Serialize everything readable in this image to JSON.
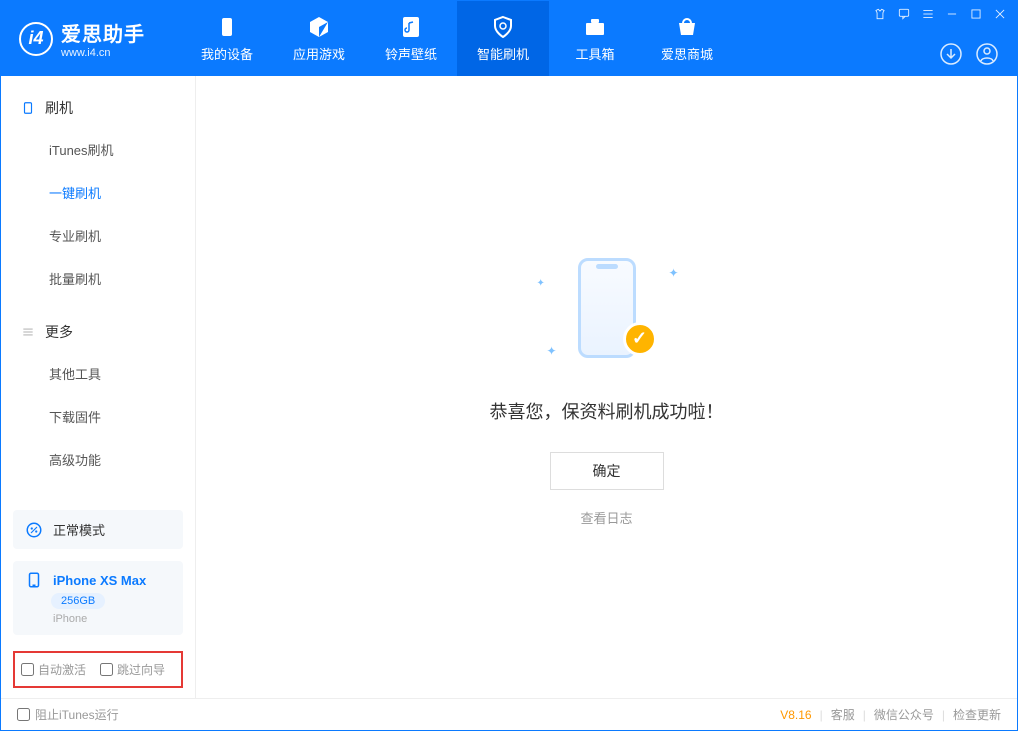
{
  "logo": {
    "title": "爱思助手",
    "sub": "www.i4.cn"
  },
  "nav": [
    {
      "label": "我的设备"
    },
    {
      "label": "应用游戏"
    },
    {
      "label": "铃声壁纸"
    },
    {
      "label": "智能刷机"
    },
    {
      "label": "工具箱"
    },
    {
      "label": "爱思商城"
    }
  ],
  "sidebar": {
    "group1": {
      "title": "刷机",
      "items": [
        "iTunes刷机",
        "一键刷机",
        "专业刷机",
        "批量刷机"
      ]
    },
    "group2": {
      "title": "更多",
      "items": [
        "其他工具",
        "下载固件",
        "高级功能"
      ]
    },
    "mode": "正常模式",
    "device": {
      "name": "iPhone XS Max",
      "storage": "256GB",
      "type": "iPhone"
    },
    "options": {
      "auto_activate": "自动激活",
      "skip_wizard": "跳过向导"
    }
  },
  "main": {
    "message": "恭喜您，保资料刷机成功啦！",
    "ok": "确定",
    "view_log": "查看日志"
  },
  "footer": {
    "block_itunes": "阻止iTunes运行",
    "version": "V8.16",
    "links": [
      "客服",
      "微信公众号",
      "检查更新"
    ]
  }
}
